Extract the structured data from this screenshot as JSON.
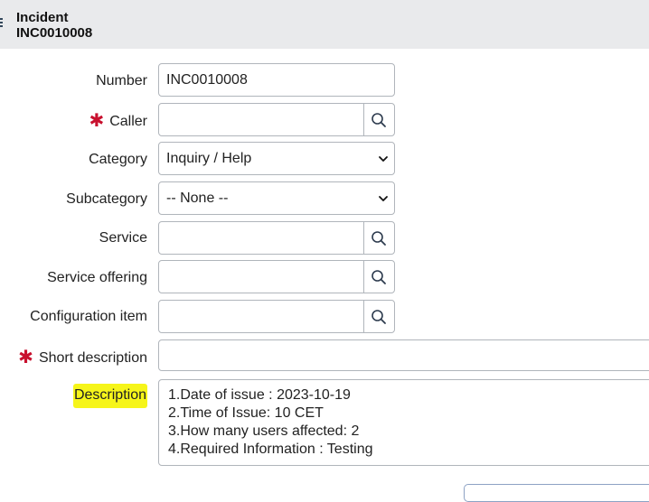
{
  "header": {
    "title": "Incident",
    "number": "INC0010008"
  },
  "form": {
    "number": {
      "label": "Number",
      "value": "INC0010008"
    },
    "caller": {
      "label": "Caller",
      "value": "",
      "required": true
    },
    "category": {
      "label": "Category",
      "value": "Inquiry / Help"
    },
    "subcategory": {
      "label": "Subcategory",
      "value": "-- None --"
    },
    "service": {
      "label": "Service",
      "value": ""
    },
    "service_offering": {
      "label": "Service offering",
      "value": ""
    },
    "configuration_item": {
      "label": "Configuration item",
      "value": ""
    },
    "short_description": {
      "label": "Short description",
      "value": "",
      "required": true
    },
    "description": {
      "label": "Description",
      "highlight_color": "#f6f51a",
      "lines": [
        "1.Date of issue : 2023-10-19",
        "2.Time of Issue: 10 CET",
        "3.How many users affected: 2",
        "4.Required Information : Testing"
      ]
    }
  },
  "colors": {
    "required_marker": "#c8102e",
    "header_bg": "#e9eaec",
    "field_border": "#b0b5bb"
  },
  "icons": {
    "lookup": "search-icon",
    "dropdown": "chevron-down-icon",
    "required": "asterisk-icon"
  }
}
